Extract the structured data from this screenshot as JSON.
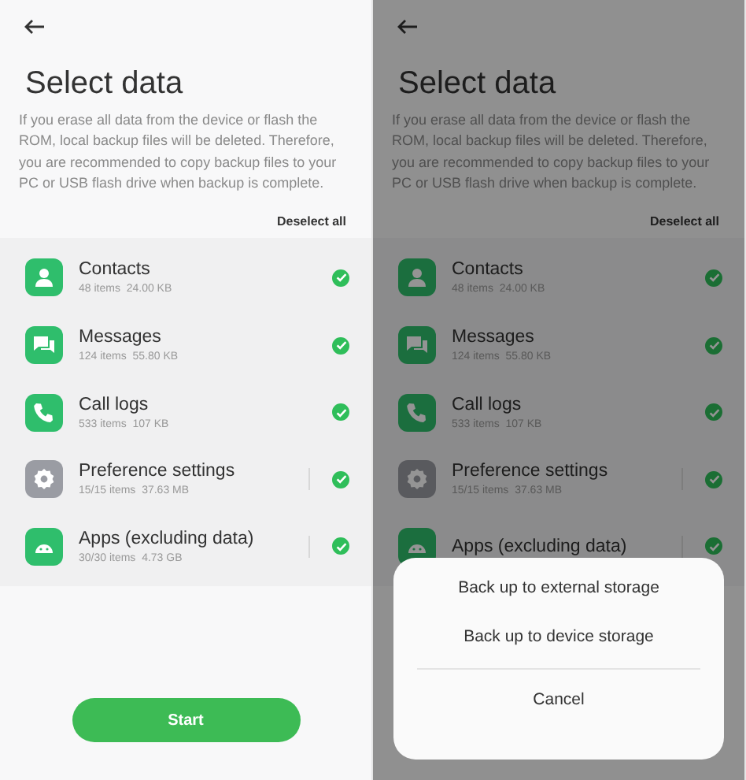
{
  "screens": [
    {
      "dimmed": false,
      "title": "Select data",
      "description": "If you erase all data from the device or flash the ROM, local backup files will be deleted. Therefore, you are recommended to copy backup files to your PC or USB flash drive when backup is complete.",
      "deselect_all": "Deselect all",
      "items": [
        {
          "kind": "contact",
          "name": "Contacts",
          "meta": "48 items  24.00 KB",
          "checked": true,
          "divider": false
        },
        {
          "kind": "message",
          "name": "Messages",
          "meta": "124 items  55.80 KB",
          "checked": true,
          "divider": false
        },
        {
          "kind": "phone",
          "name": "Call logs",
          "meta": "533 items  107 KB",
          "checked": true,
          "divider": false
        },
        {
          "kind": "settings",
          "name": "Preference settings",
          "meta": "15/15 items  37.63 MB",
          "checked": true,
          "divider": true
        },
        {
          "kind": "app",
          "name": "Apps (excluding data)",
          "meta": "30/30 items  4.73 GB",
          "checked": true,
          "divider": true
        }
      ],
      "start_button": "Start"
    },
    {
      "dimmed": true,
      "title": "Select data",
      "description": "If you erase all data from the device or flash the ROM, local backup files will be deleted. Therefore, you are recommended to copy backup files to your PC or USB flash drive when backup is complete.",
      "deselect_all": "Deselect all",
      "items": [
        {
          "kind": "contact",
          "name": "Contacts",
          "meta": "48 items  24.00 KB",
          "checked": true,
          "divider": false
        },
        {
          "kind": "message",
          "name": "Messages",
          "meta": "124 items  55.80 KB",
          "checked": true,
          "divider": false
        },
        {
          "kind": "phone",
          "name": "Call logs",
          "meta": "533 items  107 KB",
          "checked": true,
          "divider": false
        },
        {
          "kind": "settings",
          "name": "Preference settings",
          "meta": "15/15 items  37.63 MB",
          "checked": true,
          "divider": true
        },
        {
          "kind": "app",
          "name": "Apps (excluding data)",
          "checked": true,
          "divider": true
        }
      ],
      "sheet": {
        "options": [
          "Back up to external storage",
          "Back up to device storage"
        ],
        "cancel": "Cancel"
      }
    }
  ]
}
